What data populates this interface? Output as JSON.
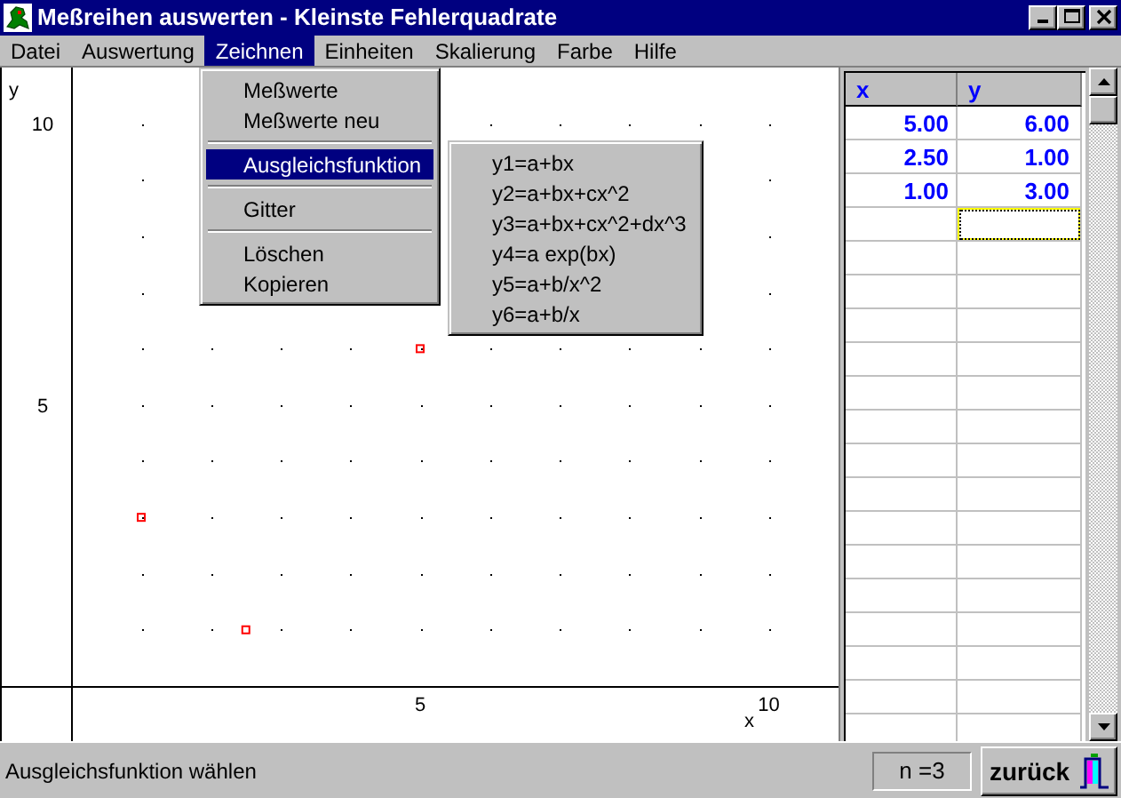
{
  "window": {
    "title": "Meßreihen auswerten - Kleinste Fehlerquadrate"
  },
  "menu_bar": [
    {
      "label": "Datei",
      "selected": false
    },
    {
      "label": "Auswertung",
      "selected": false
    },
    {
      "label": "Zeichnen",
      "selected": true
    },
    {
      "label": "Einheiten",
      "selected": false
    },
    {
      "label": "Skalierung",
      "selected": false
    },
    {
      "label": "Farbe",
      "selected": false
    },
    {
      "label": "Hilfe",
      "selected": false
    }
  ],
  "open_menu": {
    "items": [
      {
        "kind": "item",
        "label": "Meßwerte",
        "selected": false
      },
      {
        "kind": "item",
        "label": "Meßwerte neu",
        "selected": false
      },
      {
        "kind": "separator"
      },
      {
        "kind": "submenu",
        "label": "Ausgleichsfunktion",
        "selected": true
      },
      {
        "kind": "separator"
      },
      {
        "kind": "item",
        "label": "Gitter",
        "selected": false
      },
      {
        "kind": "separator"
      },
      {
        "kind": "item",
        "label": "Löschen",
        "selected": false
      },
      {
        "kind": "item",
        "label": "Kopieren",
        "selected": false
      }
    ]
  },
  "submenu": {
    "items": [
      {
        "label": "y1=a+bx",
        "selected": false
      },
      {
        "label": "y2=a+bx+cx^2",
        "selected": false
      },
      {
        "label": "y3=a+bx+cx^2+dx^3",
        "selected": false
      },
      {
        "label": "y4=a exp(bx)",
        "selected": false
      },
      {
        "label": "y5=a+b/x^2",
        "selected": false
      },
      {
        "label": "y6=a+b/x",
        "selected": false
      }
    ]
  },
  "plot": {
    "grid": true,
    "chart_data": {
      "type": "scatter",
      "xlabel": "x",
      "ylabel": "y",
      "x": [
        5,
        2.5,
        1
      ],
      "series": [
        {
          "color": "#ff0000",
          "values": [
            6,
            1,
            3
          ]
        }
      ],
      "xlim": [
        -1,
        11
      ],
      "ylim": [
        0,
        11
      ],
      "xticks": [
        5,
        10
      ],
      "yticks": [
        5,
        10
      ]
    }
  },
  "table": {
    "columns": [
      "x",
      "y"
    ],
    "rows": [
      [
        "5.00",
        "6.00"
      ],
      [
        "2.50",
        "1.00"
      ],
      [
        "1.00",
        "3.00"
      ]
    ],
    "entry_row": [
      {
        "focused": false
      },
      {
        "focused": true
      }
    ]
  },
  "status_bar": {
    "message": "Ausgleichsfunktion wählen",
    "count": "n =3",
    "back_button": "zurück"
  }
}
